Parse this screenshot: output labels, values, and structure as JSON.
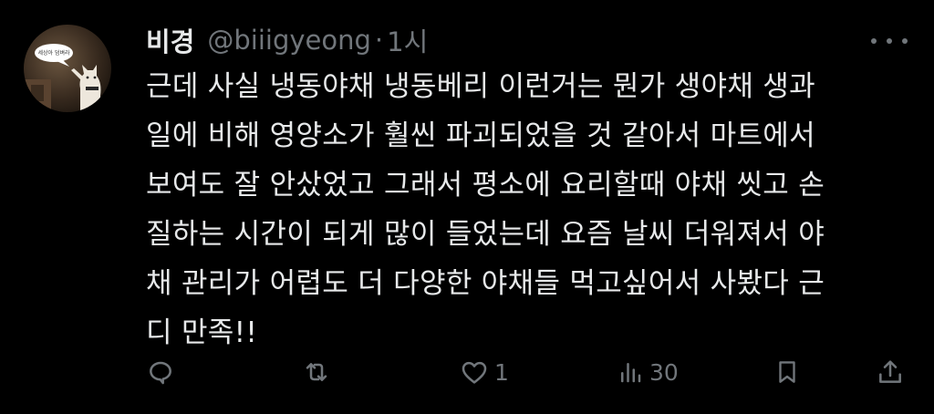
{
  "author": {
    "name": "비경",
    "handle": "@biiigyeong",
    "separator": "·",
    "time": "1시"
  },
  "avatar": {
    "bubble_text": "세상아 덤벼라"
  },
  "tweet": {
    "lines": [
      "근데 사실 냉동야채 냉동베리 이런거는 뭔가 생야채 생과",
      "일에 비해 영양소가 훨씬 파괴되었을 것 같아서 마트에서",
      "보여도 잘 안샀었고 그래서 평소에 요리할때 야채 씻고 손",
      "질하는 시간이 되게 많이 들었는데 요즘 날씨 더워져서 야",
      "채 관리가 어렵도 더 다양한 야채들 먹고싶어서 사봤다 근",
      "디 만족!!"
    ]
  },
  "actions": {
    "reply": {
      "icon": "reply-icon",
      "count": ""
    },
    "retweet": {
      "icon": "retweet-icon",
      "count": ""
    },
    "like": {
      "icon": "heart-icon",
      "count": "1"
    },
    "views": {
      "icon": "views-icon",
      "count": "30"
    },
    "bookmark": {
      "icon": "bookmark-icon"
    },
    "share": {
      "icon": "share-icon"
    }
  },
  "colors": {
    "background": "#000000",
    "text": "#e7e9ea",
    "secondary": "#71767b"
  }
}
